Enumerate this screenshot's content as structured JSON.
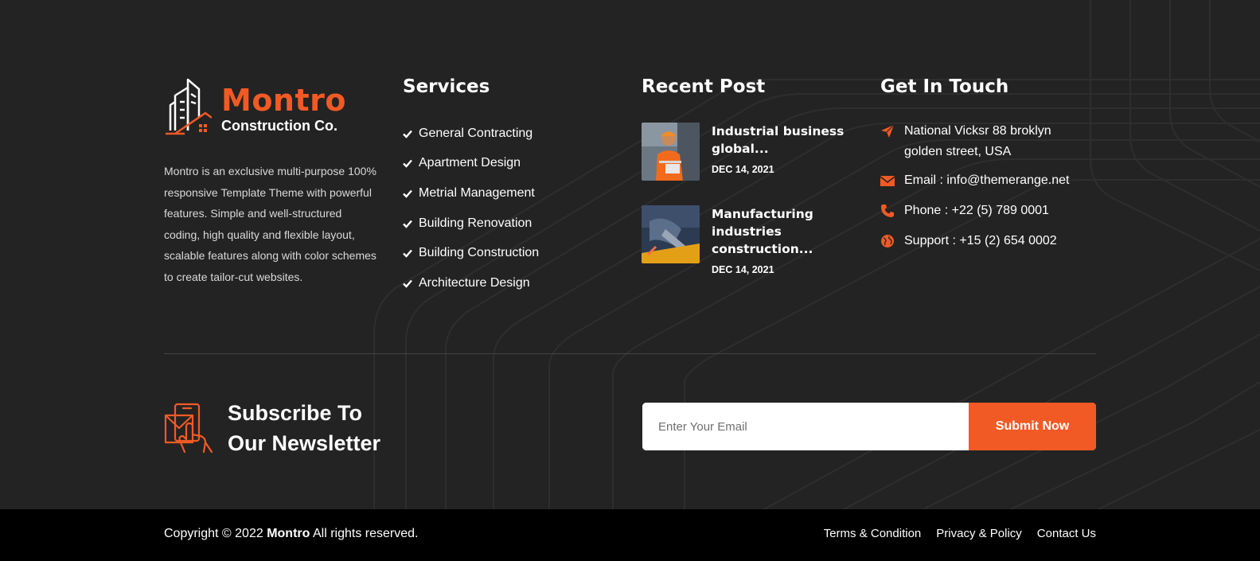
{
  "colors": {
    "accent": "#f15a24",
    "background": "#232323",
    "bottom_bar": "#000000"
  },
  "brand": {
    "name": "Montro",
    "subtitle": "Construction Co.",
    "description": "Montro is an exclusive multi-purpose 100% responsive Template Theme with powerful features. Simple and well-structured coding, high quality and flexible layout, scalable features along with color schemes to create tailor-cut websites."
  },
  "services": {
    "title": "Services",
    "items": [
      {
        "label": "General Contracting"
      },
      {
        "label": "Apartment Design"
      },
      {
        "label": "Metrial Management"
      },
      {
        "label": "Building Renovation"
      },
      {
        "label": "Building Construction"
      },
      {
        "label": "Architecture Design"
      }
    ]
  },
  "recent": {
    "title": "Recent Post",
    "posts": [
      {
        "title": "Industrial business global...",
        "date": "DEC 14, 2021"
      },
      {
        "title": "Manufacturing industries construction...",
        "date": "DEC 14, 2021"
      }
    ]
  },
  "contact": {
    "title": "Get In Touch",
    "items": [
      {
        "icon": "paper-plane-icon",
        "text": "National Vicksr 88 broklyn golden street, USA"
      },
      {
        "icon": "envelope-icon",
        "text": "Email : info@themerange.net"
      },
      {
        "icon": "phone-icon",
        "text": "Phone : +22 (5) 789 0001"
      },
      {
        "icon": "globe-icon",
        "text": "Support : +15 (2) 654 0002"
      }
    ]
  },
  "newsletter": {
    "title_line1": "Subscribe To",
    "title_line2": "Our Newsletter",
    "placeholder": "Enter Your Email",
    "button": "Submit Now"
  },
  "footer": {
    "copyright_prefix": "Copyright © 2022 ",
    "copyright_brand": "Montro",
    "copyright_suffix": " All rights reserved.",
    "links": [
      {
        "label": "Terms & Condition"
      },
      {
        "label": "Privacy & Policy"
      },
      {
        "label": "Contact Us"
      }
    ]
  }
}
